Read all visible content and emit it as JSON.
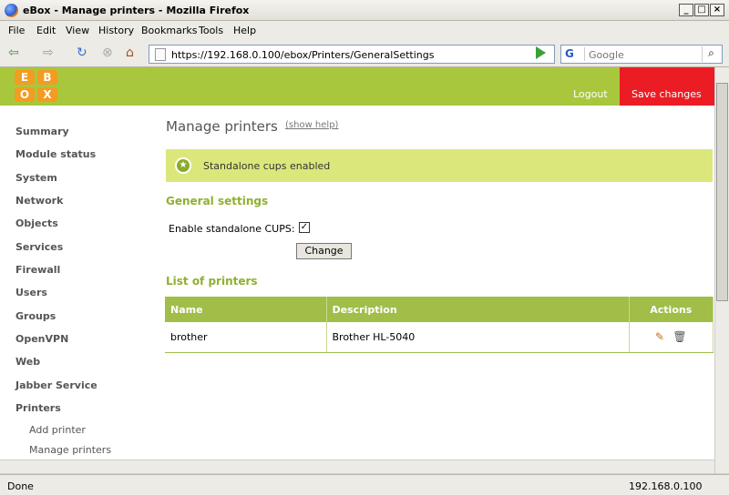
{
  "window": {
    "title": "eBox - Manage printers - Mozilla Firefox"
  },
  "menu": [
    "File",
    "Edit",
    "View",
    "History",
    "Bookmarks",
    "Tools",
    "Help"
  ],
  "nav": {
    "url": "https://192.168.0.100/ebox/Printers/GeneralSettings",
    "search_placeholder": "Google"
  },
  "header": {
    "logo": [
      "E",
      "B",
      "O",
      "X"
    ],
    "logout": "Logout",
    "save": "Save changes"
  },
  "sidebar": {
    "items": [
      "Summary",
      "Module status",
      "System",
      "Network",
      "Objects",
      "Services",
      "Firewall",
      "Users",
      "Groups",
      "OpenVPN",
      "Web",
      "Jabber Service",
      "Printers"
    ],
    "subitems": [
      "Add printer",
      "Manage printers"
    ]
  },
  "main": {
    "title": "Manage printers",
    "show_help": "(show help)",
    "note": "Standalone cups enabled",
    "general_title": "General settings",
    "enable_label": "Enable standalone CUPS:",
    "change_button": "Change",
    "list_title": "List of printers",
    "columns": [
      "Name",
      "Description",
      "Actions"
    ],
    "rows": [
      {
        "name": "brother",
        "description": "Brother HL-5040"
      }
    ]
  },
  "status": {
    "text": "Done",
    "host": "192.168.0.100"
  },
  "colors": {
    "accent": "#a8c73c",
    "save": "#ec1c24"
  }
}
